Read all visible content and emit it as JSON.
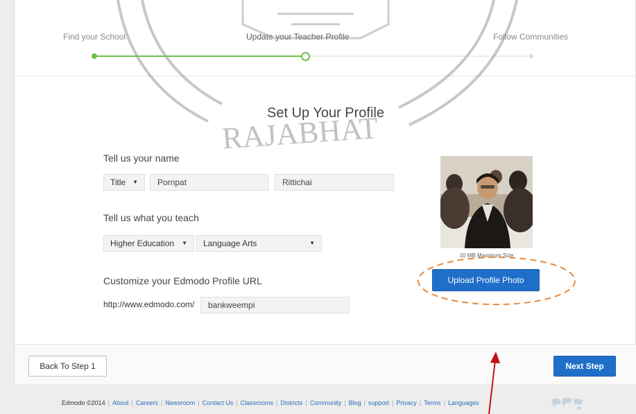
{
  "progress": {
    "steps": [
      {
        "label": "Find your School",
        "state": "done"
      },
      {
        "label": "Update your Teacher Profile",
        "state": "current"
      },
      {
        "label": "Follow Communities",
        "state": "todo"
      }
    ]
  },
  "page_title": "Set Up Your Profile",
  "name_section": {
    "label": "Tell us your name",
    "title_select": "Title",
    "first_name": "Pornpat",
    "last_name": "Rittichai"
  },
  "teach_section": {
    "label": "Tell us what you teach",
    "level_select": "Higher Education",
    "subject_select": "Language Arts"
  },
  "url_section": {
    "label": "Customize your Edmodo Profile URL",
    "prefix": "http://www.edmodo.com/",
    "value": "bankweempi"
  },
  "photo": {
    "max_size": "10 MB Maximum Size",
    "upload_label": "Upload Profile Photo"
  },
  "actions": {
    "back_label": "Back To Step 1",
    "next_label": "Next Step"
  },
  "watermark": {
    "text": "RAJABHAT"
  },
  "footer": {
    "copyright": "Edmodo ©2014",
    "links": [
      "About",
      "Careers",
      "Newsroom",
      "Contact Us",
      "Classrooms",
      "Districts",
      "Community",
      "Blog",
      "support",
      "Privacy",
      "Terms",
      "Languages"
    ]
  },
  "colors": {
    "accent_green": "#6dc04b",
    "button_blue": "#1f6fc9",
    "annotation_orange": "#e8893a",
    "annotation_red": "#c0111a"
  }
}
